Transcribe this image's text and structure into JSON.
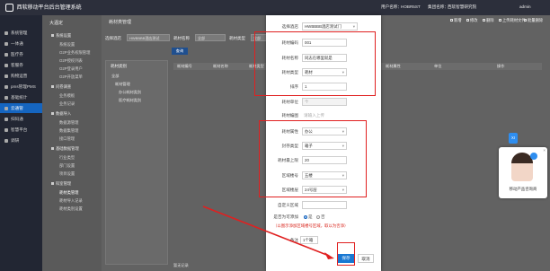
{
  "header": {
    "app_title": "西软移动平台后台管理系统",
    "user_label": "用户名称：",
    "user_value": "HOBR5ST",
    "company_label": "集团名称：",
    "company_value": "西软智慧研究院",
    "account": "admin"
  },
  "sidebar": {
    "items": [
      {
        "label": "系统管理",
        "active": false
      },
      {
        "label": "一体通",
        "active": false
      },
      {
        "label": "医疗券",
        "active": false
      },
      {
        "label": "客服券",
        "active": false
      },
      {
        "label": "购物运营",
        "active": false
      },
      {
        "label": "pms管理PMS",
        "active": false
      },
      {
        "label": "基础统计",
        "active": false
      },
      {
        "label": "云通管",
        "active": true
      },
      {
        "label": "扫码通",
        "active": false
      },
      {
        "label": "智慧平台",
        "active": false
      },
      {
        "label": "调研",
        "active": false
      }
    ]
  },
  "subnav": {
    "title": "大酒定",
    "items": [
      {
        "label": "系统设置",
        "type": "group"
      },
      {
        "label": "系统设置",
        "type": "child"
      },
      {
        "label": "O2P业务权限管理",
        "type": "child"
      },
      {
        "label": "O2P授权列表",
        "type": "child"
      },
      {
        "label": "O2P登录用户",
        "type": "child"
      },
      {
        "label": "O2P开放菜单",
        "type": "child"
      },
      {
        "label": "问卷调查",
        "type": "group"
      },
      {
        "label": "业务模板",
        "type": "child"
      },
      {
        "label": "业务记录",
        "type": "child"
      },
      {
        "label": "数据导入",
        "type": "group"
      },
      {
        "label": "数据源管理",
        "type": "child"
      },
      {
        "label": "数据集管理",
        "type": "child"
      },
      {
        "label": "接口管理",
        "type": "child"
      },
      {
        "label": "基础数据管理",
        "type": "group"
      },
      {
        "label": "行业类型",
        "type": "child"
      },
      {
        "label": "部门设置",
        "type": "child"
      },
      {
        "label": "项目设置",
        "type": "child"
      },
      {
        "label": "科室管理",
        "type": "group"
      },
      {
        "label": "耗材类管理",
        "type": "child"
      },
      {
        "label": "耗材导入记录",
        "type": "child"
      },
      {
        "label": "耗材类别设置",
        "type": "child"
      }
    ]
  },
  "main": {
    "tab": "耗材类管理",
    "toolbar": [
      "新增",
      "修改",
      "删除",
      "上传耗材文件",
      "批量删除"
    ],
    "filters": [
      {
        "label": "选择酒店",
        "value": "HWBBBB酒店测试"
      },
      {
        "label": "耗材名称",
        "value": "全部"
      },
      {
        "label": "耗材类型",
        "value": "全部"
      },
      {
        "label": "耗材属性",
        "value": "全部"
      }
    ],
    "search_button": "查询",
    "tree_title": "耗材类别",
    "tree_nodes": [
      "全部",
      "耗材管理",
      "办公耗材类别",
      "医疗耗材类别"
    ],
    "columns": [
      "耗材编号",
      "耗材名称",
      "耗材类型",
      "耗材属性",
      "单位",
      "操作"
    ],
    "pager": "暂无记录"
  },
  "modal": {
    "hotel_label": "选择酒店",
    "hotel_value": "HWBBBB酒店测试门",
    "code_label": "耗材编码",
    "code_value": "001",
    "name_label": "耗材名称",
    "name_value": "同志在哪里就是",
    "type_label": "耗材类型",
    "type_value": "耗材",
    "sort_label": "排序",
    "sort_value": "1",
    "unit_label": "耗材单位",
    "unit_value": "个",
    "photo_label": "耗材编图",
    "photo_placeholder": "请输入上传",
    "attr_label": "耗材属性",
    "attr_value": "办公",
    "package_label": "封存类型",
    "package_value": "箱子",
    "limit_label": "耗材最上限",
    "limit_value": "20",
    "area_label": "区域楼号",
    "area_value": "五楼",
    "zone_label": "区域楼层",
    "zone_value": "24号层",
    "custom_label": "自定义区域",
    "custom_value": "",
    "show_label": "是否为可添加",
    "radio_yes": "是",
    "radio_no": "否",
    "warning": "（以图示添加区域楼号区域，取以为否添）",
    "remark_label": "备注",
    "remark_value": "1个箱",
    "save_button": "保存",
    "cancel_button": "取消"
  },
  "service": {
    "tab": "XI",
    "label": "移动产品咨询商",
    "close": "×"
  },
  "colors": {
    "highlight_red": "#e02020",
    "primary_blue": "#1877d2",
    "sidebar_bg": "#222633"
  }
}
